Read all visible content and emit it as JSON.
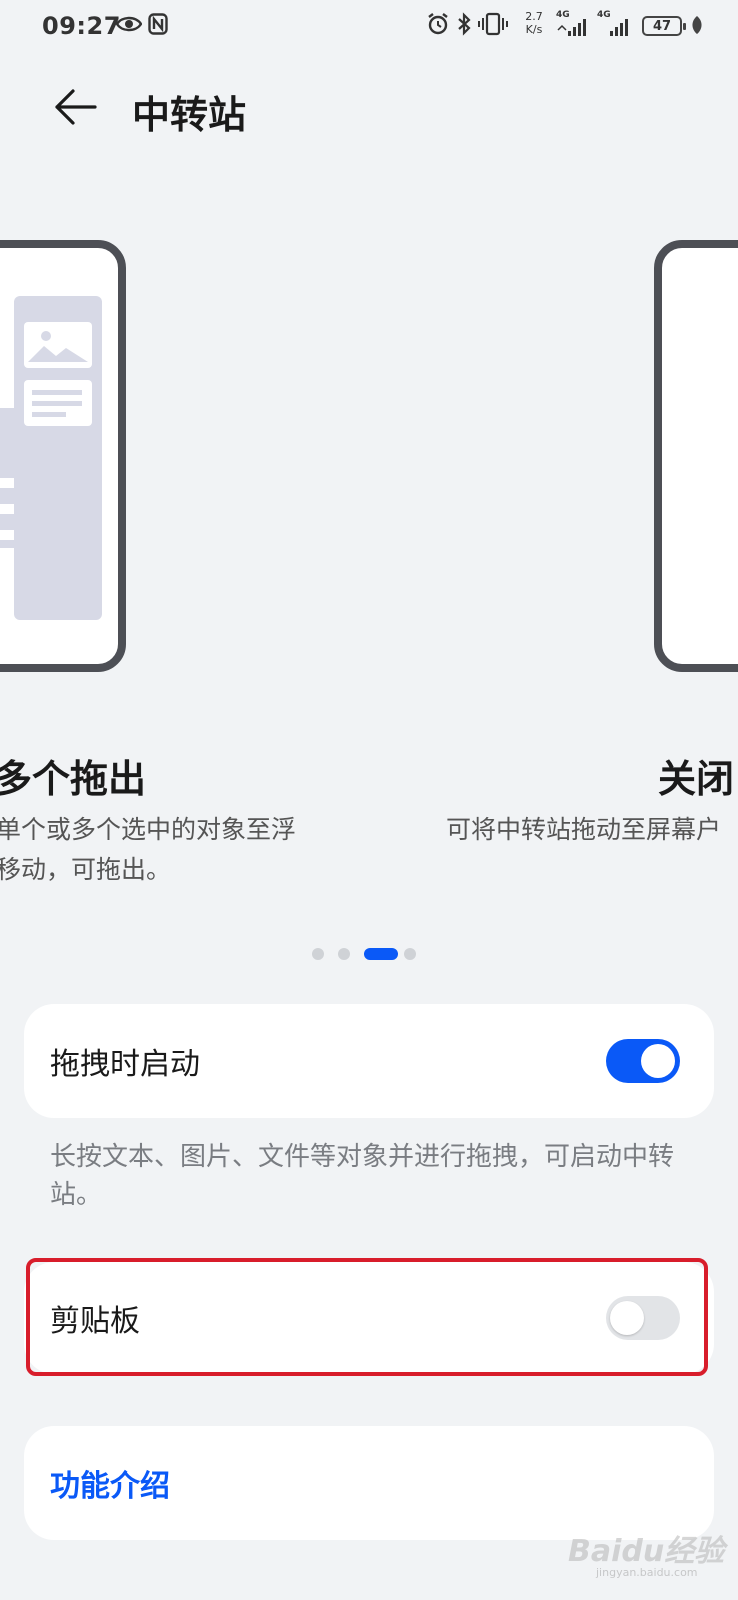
{
  "status_bar": {
    "time": "09:27",
    "net_speed_value": "2.7",
    "net_speed_unit": "K/s",
    "signal_label_1": "4G",
    "signal_label_2": "4G",
    "battery": "47"
  },
  "header": {
    "title": "中转站"
  },
  "carousel": {
    "slides": [
      {
        "title": "多个拖出",
        "desc_line1": "单个或多个选中的对象至浮",
        "desc_line2": "移动，可拖出。"
      },
      {
        "title": "关闭",
        "desc_line1": "可将中转站拖动至屏幕户",
        "desc_line2": ""
      }
    ],
    "page_count": 4,
    "active_page": 3
  },
  "settings": {
    "drag_launch": {
      "label": "拖拽时启动",
      "enabled": true
    },
    "drag_hint": "长按文本、图片、文件等对象并进行拖拽，可启动中转站。",
    "clipboard": {
      "label": "剪贴板",
      "enabled": false
    },
    "feature_intro": {
      "label": "功能介绍"
    }
  },
  "watermark": {
    "text": "Baidu经验",
    "sub": "jingyan.baidu.com"
  },
  "colors": {
    "accent": "#0a59f7",
    "highlight": "#d81d2b",
    "background": "#f1f3f5"
  }
}
